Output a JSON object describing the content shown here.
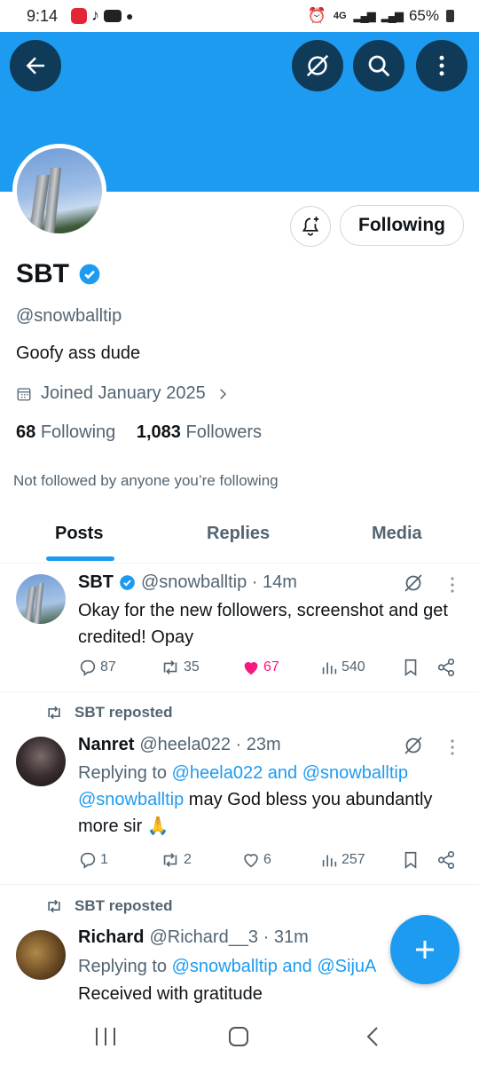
{
  "status_bar": {
    "time": "9:14",
    "network": "4G",
    "battery": "65%"
  },
  "header": {
    "back_icon": "arrow-left-icon",
    "grok_icon": "grok-icon",
    "search_icon": "search-icon",
    "more_icon": "more-vertical-icon"
  },
  "profile": {
    "name": "SBT",
    "handle": "@snowballtip",
    "bio": "Goofy ass dude",
    "joined": "Joined January 2025",
    "following_count": "68",
    "following_label": "Following",
    "followers_count": "1,083",
    "followers_label": "Followers",
    "not_followed": "Not followed by anyone you’re following",
    "following_button": "Following",
    "colors": {
      "accent": "#1d9bf0",
      "banner": "#1d9bf0",
      "like": "#f91880"
    }
  },
  "tabs": [
    {
      "label": "Posts"
    },
    {
      "label": "Replies"
    },
    {
      "label": "Media"
    }
  ],
  "posts": [
    {
      "name": "SBT",
      "meta": "@snowballtip · 14m",
      "text": "Okay for the new followers, screenshot and get credited! Opay",
      "replies": "87",
      "reposts": "35",
      "likes": "67",
      "views": "540"
    },
    {
      "repost_label": "SBT reposted",
      "name": "Nanret",
      "meta": "@heela022 · 23m",
      "replying_prefix": "Replying to ",
      "replying_users": "@heela022 and @snowballtip",
      "mention": "@snowballtip",
      "text": " may God bless you abundantly more sir 🙏",
      "replies": "1",
      "reposts": "2",
      "likes": "6",
      "views": "257"
    },
    {
      "repost_label": "SBT reposted",
      "name": "Richard",
      "meta": "@Richard__3 · 31m",
      "replying_prefix": "Replying to ",
      "replying_users": "@snowballtip and @SijuA",
      "text": "Received with gratitude"
    }
  ],
  "fab": {
    "icon": "plus-icon"
  }
}
